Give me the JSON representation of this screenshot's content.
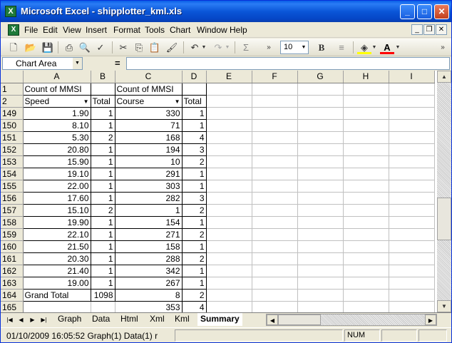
{
  "window": {
    "title": "Microsoft Excel - shipplotter_kml.xls",
    "app_icon": "excel-icon"
  },
  "caption_buttons": {
    "minimize": "_",
    "maximize": "□",
    "close": "✕"
  },
  "menu": {
    "items": [
      "File",
      "Edit",
      "View",
      "Insert",
      "Format",
      "Tools",
      "Chart",
      "Window",
      "Help"
    ],
    "mdi": {
      "minimize": "_",
      "restore": "❐",
      "close": "✕"
    }
  },
  "toolbar": {
    "font_size": "10",
    "bold": "B",
    "sum": "Σ",
    "font_color_letter": "A"
  },
  "formula_bar": {
    "name_box": "Chart Area",
    "equals": "=",
    "formula": ""
  },
  "columns": [
    "A",
    "B",
    "C",
    "D",
    "E",
    "F",
    "G",
    "H",
    "I"
  ],
  "rows": [
    {
      "n": "1",
      "a": "Count of MMSI",
      "b": "",
      "c": "Count of MMSI",
      "d": ""
    },
    {
      "n": "2",
      "a": "Speed",
      "b": "Total",
      "c": "Course",
      "d": "Total"
    },
    {
      "n": "149",
      "a": "1.90",
      "b": "1",
      "c": "330",
      "d": "1"
    },
    {
      "n": "150",
      "a": "8.10",
      "b": "1",
      "c": "71",
      "d": "1"
    },
    {
      "n": "151",
      "a": "5.30",
      "b": "2",
      "c": "168",
      "d": "4"
    },
    {
      "n": "152",
      "a": "20.80",
      "b": "1",
      "c": "194",
      "d": "3"
    },
    {
      "n": "153",
      "a": "15.90",
      "b": "1",
      "c": "10",
      "d": "2"
    },
    {
      "n": "154",
      "a": "19.10",
      "b": "1",
      "c": "291",
      "d": "1"
    },
    {
      "n": "155",
      "a": "22.00",
      "b": "1",
      "c": "303",
      "d": "1"
    },
    {
      "n": "156",
      "a": "17.60",
      "b": "1",
      "c": "282",
      "d": "3"
    },
    {
      "n": "157",
      "a": "15.10",
      "b": "2",
      "c": "1",
      "d": "2"
    },
    {
      "n": "158",
      "a": "19.90",
      "b": "1",
      "c": "154",
      "d": "1"
    },
    {
      "n": "159",
      "a": "22.10",
      "b": "1",
      "c": "271",
      "d": "2"
    },
    {
      "n": "160",
      "a": "21.50",
      "b": "1",
      "c": "158",
      "d": "1"
    },
    {
      "n": "161",
      "a": "20.30",
      "b": "1",
      "c": "288",
      "d": "2"
    },
    {
      "n": "162",
      "a": "21.40",
      "b": "1",
      "c": "342",
      "d": "1"
    },
    {
      "n": "163",
      "a": "19.00",
      "b": "1",
      "c": "267",
      "d": "1"
    },
    {
      "n": "164",
      "a": "Grand Total",
      "b": "1098",
      "c": "8",
      "d": "2"
    },
    {
      "n": "165",
      "a": "",
      "b": "",
      "c": "353",
      "d": "4"
    }
  ],
  "sheet_tabs": [
    "Graph",
    "Data",
    "Html",
    "Xml",
    "Kml",
    "Summary"
  ],
  "active_tab": "Summary",
  "status": {
    "text": "01/10/2009 16:05:52 Graph(1) Data(1) r",
    "num": "NUM"
  }
}
